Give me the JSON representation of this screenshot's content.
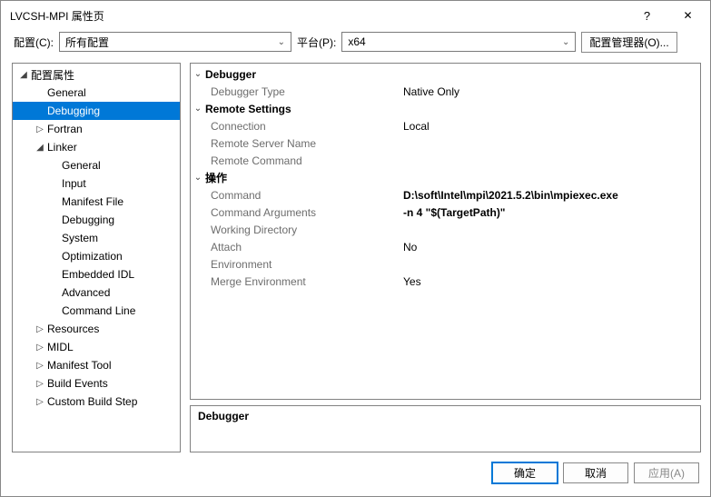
{
  "window": {
    "title": "LVCSH-MPI 属性页"
  },
  "toolbar": {
    "config_label": "配置(C):",
    "config_value": "所有配置",
    "platform_label": "平台(P):",
    "platform_value": "x64",
    "manager_label": "配置管理器(O)..."
  },
  "tree": {
    "root": "配置属性",
    "items": [
      {
        "label": "General",
        "depth": 2
      },
      {
        "label": "Debugging",
        "depth": 2,
        "selected": true
      },
      {
        "label": "Fortran",
        "depth": 2,
        "expandable": "closed"
      },
      {
        "label": "Linker",
        "depth": 2,
        "expandable": "open"
      },
      {
        "label": "General",
        "depth": 3
      },
      {
        "label": "Input",
        "depth": 3
      },
      {
        "label": "Manifest File",
        "depth": 3
      },
      {
        "label": "Debugging",
        "depth": 3
      },
      {
        "label": "System",
        "depth": 3
      },
      {
        "label": "Optimization",
        "depth": 3
      },
      {
        "label": "Embedded IDL",
        "depth": 3
      },
      {
        "label": "Advanced",
        "depth": 3
      },
      {
        "label": "Command Line",
        "depth": 3
      },
      {
        "label": "Resources",
        "depth": 2,
        "expandable": "closed"
      },
      {
        "label": "MIDL",
        "depth": 2,
        "expandable": "closed"
      },
      {
        "label": "Manifest Tool",
        "depth": 2,
        "expandable": "closed"
      },
      {
        "label": "Build Events",
        "depth": 2,
        "expandable": "closed"
      },
      {
        "label": "Custom Build Step",
        "depth": 2,
        "expandable": "closed"
      }
    ]
  },
  "grid": {
    "groups": [
      {
        "header": "Debugger",
        "rows": [
          {
            "key": "Debugger Type",
            "value": "Native Only"
          }
        ]
      },
      {
        "header": "Remote Settings",
        "rows": [
          {
            "key": "Connection",
            "value": "Local"
          },
          {
            "key": "Remote Server Name",
            "value": ""
          },
          {
            "key": "Remote Command",
            "value": ""
          }
        ]
      },
      {
        "header": "操作",
        "rows": [
          {
            "key": "Command",
            "value": "D:\\soft\\Intel\\mpi\\2021.5.2\\bin\\mpiexec.exe",
            "bold": true
          },
          {
            "key": "Command Arguments",
            "value": "-n 4 \"$(TargetPath)\"",
            "bold": true
          },
          {
            "key": "Working Directory",
            "value": ""
          },
          {
            "key": "Attach",
            "value": "No"
          },
          {
            "key": "Environment",
            "value": ""
          },
          {
            "key": "Merge Environment",
            "value": "Yes"
          }
        ]
      }
    ]
  },
  "description": {
    "title": "Debugger",
    "body": ""
  },
  "footer": {
    "ok": "确定",
    "cancel": "取消",
    "apply": "应用(A)"
  }
}
